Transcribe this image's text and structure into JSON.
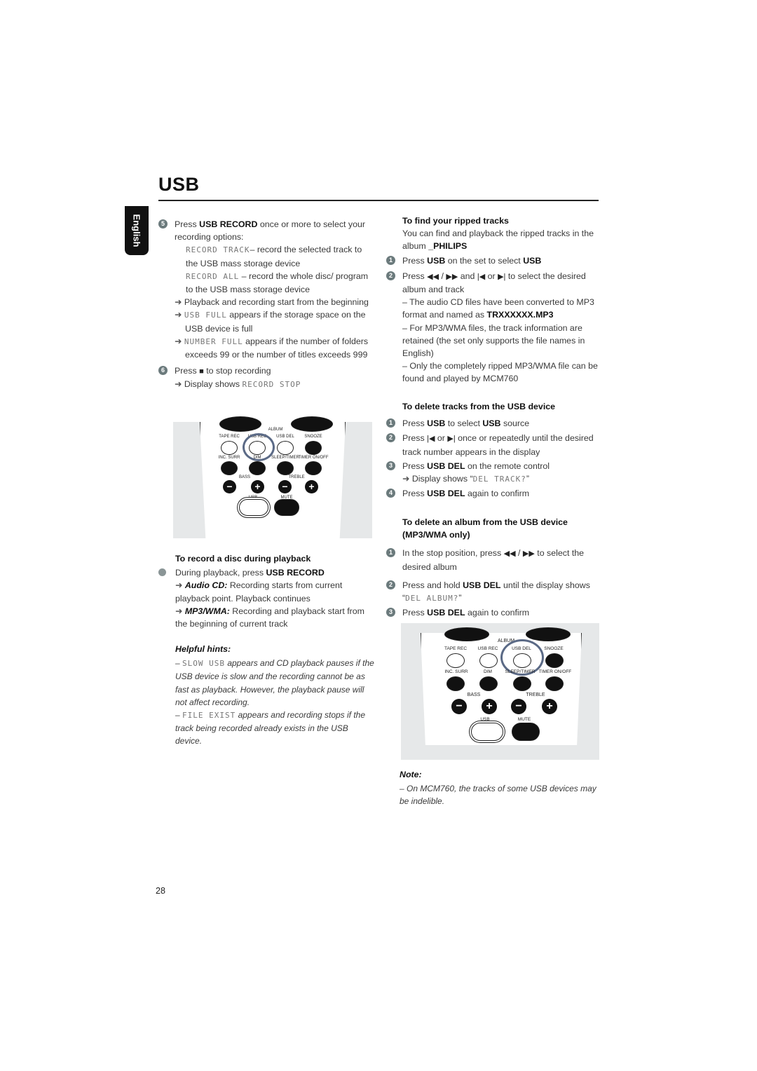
{
  "page": {
    "title": "USB",
    "language_tab": "English",
    "page_number": "28"
  },
  "left": {
    "step5": {
      "number": "5",
      "pre": "Press ",
      "key": "USB RECORD",
      "post": " once or more to select your recording options:",
      "opt1_lcd": "RECORD TRACK",
      "opt1_text": "– record the selected track to the USB mass storage device",
      "opt2_lcd": "RECORD ALL",
      "opt2_text": " – record the whole disc/ program to the USB mass storage device",
      "result1": "Playback and recording start from the beginning",
      "result2_lcd": "USB FULL",
      "result2_text": " appears if the storage space on the USB device is full",
      "result3_lcd": "NUMBER FULL",
      "result3_text": " appears if the number of folders exceeds 99 or the number of titles exceeds 999"
    },
    "step6": {
      "number": "6",
      "pre": "Press ",
      "stop_icon": "stop-icon",
      "post": " to stop recording",
      "result_pre": "Display shows ",
      "result_lcd": "RECORD STOP"
    },
    "remote1": {
      "album": "ALBUM",
      "row1": [
        "TAPE REC",
        "USB REC",
        "USB DEL",
        "SNOOZE"
      ],
      "row2": [
        "INC. SURR",
        "DIM",
        "SLEEP/TIMER",
        "TIMER ON/OFF"
      ],
      "bass": "BASS",
      "treble": "TREBLE",
      "usb": "USB",
      "mute": "MUTE",
      "highlighted": "USB REC"
    },
    "record_during_playback": {
      "heading": "To record a disc during playback",
      "bullet_pre": "During playback, press ",
      "bullet_key": "USB RECORD",
      "audio_label": "Audio CD:",
      "audio_text": " Recording starts from current playback point. Playback continues",
      "mp3_label": "MP3/WMA:",
      "mp3_text": " Recording and playback start from the beginning of current track"
    },
    "hints": {
      "heading": "Helpful hints:",
      "hint1_lcd": "SLOW USB",
      "hint1_text": " appears and CD playback pauses if the USB device is slow and the recording cannot be as fast as playback. However, the playback pause will not affect recording.",
      "hint2_lcd": "FILE EXIST",
      "hint2_text": " appears and recording stops if the track being recorded already exists in the USB device."
    }
  },
  "right": {
    "find": {
      "heading": "To find your ripped tracks",
      "intro": "You can find and playback the ripped tracks in the album ",
      "album": "_PHILIPS",
      "s1_num": "1",
      "s1_pre": "Press ",
      "s1_key": "USB",
      "s1_mid": " on the set to select ",
      "s1_key2": "USB",
      "s2_num": "2",
      "s2_pre": "Press ",
      "s2_mid1": " / ",
      "s2_mid2": " and ",
      "s2_mid3": " or ",
      "s2_post": " to select the desired album and track",
      "note1_pre": "– The audio CD files have been converted to MP3 format and named as ",
      "note1_file": "TRXXXXXX.MP3",
      "note2": "– For MP3/WMA files, the track information are retained (the set only supports the file names in English)",
      "note3": "– Only the completely ripped MP3/WMA file can be found and played by MCM760"
    },
    "delete_tracks": {
      "heading": "To delete tracks from the USB device",
      "s1_num": "1",
      "s1_pre": "Press ",
      "s1_key": "USB",
      "s1_mid": " to select ",
      "s1_key2": "USB",
      "s1_post": " source",
      "s2_num": "2",
      "s2_pre": "Press ",
      "s2_mid": " or ",
      "s2_post": " once or repeatedly until the desired track number appears in the display",
      "s3_num": "3",
      "s3_pre": "Press ",
      "s3_key": "USB DEL",
      "s3_post": " on the remote control",
      "s3_result_pre": "Display shows “",
      "s3_result_lcd": "DEL TRACK?",
      "s3_result_post": "”",
      "s4_num": "4",
      "s4_pre": "Press ",
      "s4_key": "USB DEL",
      "s4_post": " again to confirm"
    },
    "delete_album": {
      "heading": "To delete an album from the USB device (MP3/WMA only)",
      "s1_num": "1",
      "s1_pre": "In the stop position, press ",
      "s1_mid": " / ",
      "s1_post": " to select the desired album",
      "s2_num": "2",
      "s2_pre": "Press and hold ",
      "s2_key": "USB DEL",
      "s2_post": " until the display shows “",
      "s2_lcd": "DEL ALBUM?",
      "s2_end": "”",
      "s3_num": "3",
      "s3_pre": "Press ",
      "s3_key": "USB DEL",
      "s3_post": " again to confirm"
    },
    "remote2": {
      "album": "ALBUM",
      "row1": [
        "TAPE REC",
        "USB REC",
        "USB DEL",
        "SNOOZE"
      ],
      "row2": [
        "INC. SURR",
        "DIM",
        "SLEEP/TIMER",
        "TIMER ON/OFF"
      ],
      "bass": "BASS",
      "treble": "TREBLE",
      "usb": "USB",
      "mute": "MUTE",
      "highlighted": "USB DEL"
    },
    "note": {
      "heading": "Note:",
      "text": "– On MCM760, the tracks of some USB devices may be indelible."
    }
  },
  "glyphs": {
    "arrow": "➜",
    "stop": "■",
    "rewind": "◀◀",
    "ffwd": "▶▶",
    "prev": "|◀",
    "next": "▶|"
  }
}
